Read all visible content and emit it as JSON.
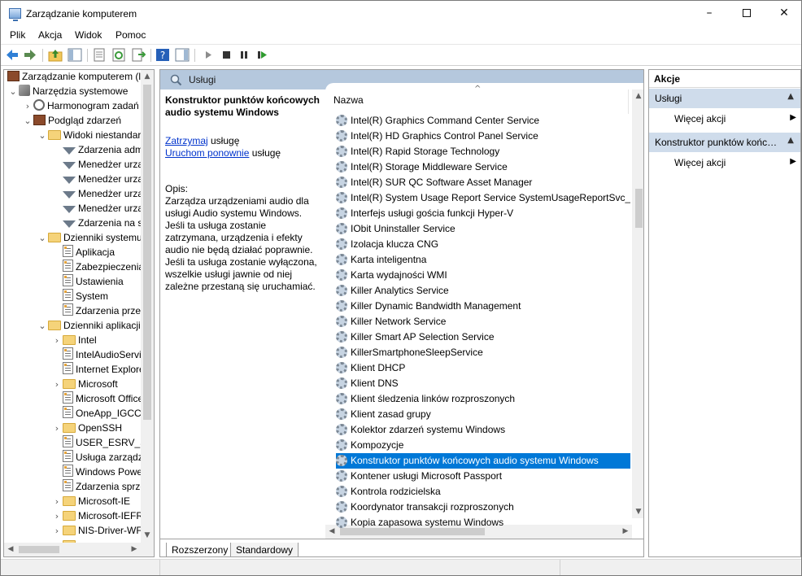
{
  "window": {
    "title": "Zarządzanie komputerem"
  },
  "menu": [
    "Plik",
    "Akcja",
    "Widok",
    "Pomoc"
  ],
  "tree": [
    {
      "label": "Zarządzanie komputerem (lokalne)",
      "indent": 0,
      "exp": "",
      "icon": "computer-icon"
    },
    {
      "label": "Narzędzia systemowe",
      "indent": 1,
      "exp": "⌄",
      "icon": "tools-icon"
    },
    {
      "label": "Harmonogram zadań",
      "indent": 2,
      "exp": "›",
      "icon": "clock-icon"
    },
    {
      "label": "Podgląd zdarzeń",
      "indent": 2,
      "exp": "⌄",
      "icon": "event-viewer-icon"
    },
    {
      "label": "Widoki niestandardowe",
      "indent": 3,
      "exp": "⌄",
      "icon": "folder-icon"
    },
    {
      "label": "Zdarzenia administracyjne",
      "indent": 4,
      "exp": "",
      "icon": "filter-icon"
    },
    {
      "label": "Menedżer urządzeń",
      "indent": 4,
      "exp": "",
      "icon": "filter-icon"
    },
    {
      "label": "Menedżer urządzeń",
      "indent": 4,
      "exp": "",
      "icon": "filter-icon"
    },
    {
      "label": "Menedżer urządzeń",
      "indent": 4,
      "exp": "",
      "icon": "filter-icon"
    },
    {
      "label": "Menedżer urządzeń",
      "indent": 4,
      "exp": "",
      "icon": "filter-icon"
    },
    {
      "label": "Zdarzenia na stronie",
      "indent": 4,
      "exp": "",
      "icon": "filter-icon"
    },
    {
      "label": "Dzienniki systemu Windows",
      "indent": 3,
      "exp": "⌄",
      "icon": "folder-icon"
    },
    {
      "label": "Aplikacja",
      "indent": 4,
      "exp": "",
      "icon": "log-icon"
    },
    {
      "label": "Zabezpieczenia",
      "indent": 4,
      "exp": "",
      "icon": "log-icon"
    },
    {
      "label": "Ustawienia",
      "indent": 4,
      "exp": "",
      "icon": "log-icon"
    },
    {
      "label": "System",
      "indent": 4,
      "exp": "",
      "icon": "log-icon"
    },
    {
      "label": "Zdarzenia przesyłane dalej",
      "indent": 4,
      "exp": "",
      "icon": "log-icon"
    },
    {
      "label": "Dzienniki aplikacji i usług",
      "indent": 3,
      "exp": "⌄",
      "icon": "folder-icon"
    },
    {
      "label": "Intel",
      "indent": 4,
      "exp": "›",
      "icon": "folder-icon"
    },
    {
      "label": "IntelAudioService",
      "indent": 4,
      "exp": "",
      "icon": "log-icon"
    },
    {
      "label": "Internet Explorer",
      "indent": 4,
      "exp": "",
      "icon": "log-icon"
    },
    {
      "label": "Microsoft",
      "indent": 4,
      "exp": "›",
      "icon": "folder-icon"
    },
    {
      "label": "Microsoft Office Alerts",
      "indent": 4,
      "exp": "",
      "icon": "log-icon"
    },
    {
      "label": "OneApp_IGCC",
      "indent": 4,
      "exp": "",
      "icon": "log-icon"
    },
    {
      "label": "OpenSSH",
      "indent": 4,
      "exp": "›",
      "icon": "folder-icon"
    },
    {
      "label": "USER_ESRV_SVC",
      "indent": 4,
      "exp": "",
      "icon": "log-icon"
    },
    {
      "label": "Usługa zarządzania kluczami",
      "indent": 4,
      "exp": "",
      "icon": "log-icon"
    },
    {
      "label": "Windows PowerShell",
      "indent": 4,
      "exp": "",
      "icon": "log-icon"
    },
    {
      "label": "Zdarzenia sprzętowe",
      "indent": 4,
      "exp": "",
      "icon": "log-icon"
    },
    {
      "label": "Microsoft-IE",
      "indent": 4,
      "exp": "›",
      "icon": "folder-icon"
    },
    {
      "label": "Microsoft-IEFRAME",
      "indent": 4,
      "exp": "›",
      "icon": "folder-icon"
    },
    {
      "label": "NIS-Driver-WFP",
      "indent": 4,
      "exp": "›",
      "icon": "folder-icon"
    },
    {
      "label": "",
      "indent": 4,
      "exp": "",
      "icon": "folder-icon"
    }
  ],
  "center": {
    "header": "Usługi",
    "detail": {
      "title": "Konstruktor punktów końcowych audio systemu Windows",
      "stop_link": "Zatrzymaj",
      "stop_suffix": " usługę",
      "restart_link": "Uruchom ponownie",
      "restart_suffix": " usługę",
      "desc_label": "Opis:",
      "desc_text": "Zarządza urządzeniami audio dla usługi Audio systemu Windows. Jeśli ta usługa zostanie zatrzymana, urządzenia i efekty audio nie będą działać poprawnie. Jeśli ta usługa zostanie wyłączona, wszelkie usługi jawnie od niej zależne przestaną się uruchamiać."
    },
    "column": "Nazwa",
    "services": [
      "Intel(R) Graphics Command Center Service",
      "Intel(R) HD Graphics Control Panel Service",
      "Intel(R) Rapid Storage Technology",
      "Intel(R) Storage Middleware Service",
      "Intel(R) SUR QC Software Asset Manager",
      "Intel(R) System Usage Report Service SystemUsageReportSvc_...",
      "Interfejs usługi gościa funkcji Hyper-V",
      "IObit Uninstaller Service",
      "Izolacja klucza CNG",
      "Karta inteligentna",
      "Karta wydajności WMI",
      "Killer Analytics Service",
      "Killer Dynamic Bandwidth Management",
      "Killer Network Service",
      "Killer Smart AP Selection Service",
      "KillerSmartphoneSleepService",
      "Klient DHCP",
      "Klient DNS",
      "Klient śledzenia linków rozproszonych",
      "Klient zasad grupy",
      "Kolektor zdarzeń systemu Windows",
      "Kompozycje",
      "Konstruktor punktów końcowych audio systemu Windows",
      "Kontener usługi Microsoft Passport",
      "Kontrola rodzicielska",
      "Koordynator transakcji rozproszonych",
      "Kopia zapasowa systemu Windows"
    ],
    "selected_index": 22,
    "tabs": [
      "Rozszerzony",
      "Standardowy"
    ]
  },
  "actions": {
    "title": "Akcje",
    "sections": [
      {
        "label": "Usługi",
        "item": "Więcej akcji"
      },
      {
        "label": "Konstruktor punktów końcowych audio systemu Windows",
        "item": "Więcej akcji"
      }
    ]
  }
}
